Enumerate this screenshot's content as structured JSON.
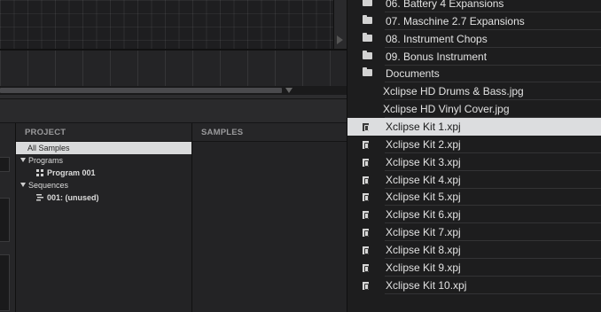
{
  "project_panel": {
    "header": "PROJECT",
    "items": [
      {
        "label": "All Samples"
      },
      {
        "label": "Programs"
      },
      {
        "label": "Program 001"
      },
      {
        "label": "Sequences"
      },
      {
        "label": "001: (unused)"
      }
    ]
  },
  "samples_panel": {
    "header": "SAMPLES"
  },
  "browser": {
    "items": [
      {
        "label": "06. Battery 4 Expansions",
        "icon": "folder-icon"
      },
      {
        "label": "07. Maschine 2.7 Expansions",
        "icon": "folder-icon"
      },
      {
        "label": "08. Instrument Chops",
        "icon": "folder-icon"
      },
      {
        "label": "09. Bonus Instrument",
        "icon": "folder-icon"
      },
      {
        "label": "Documents",
        "icon": "folder-icon"
      },
      {
        "label": "Xclipse HD Drums & Bass.jpg",
        "icon": "none"
      },
      {
        "label": "Xclipse  HD Vinyl Cover.jpg",
        "icon": "none"
      },
      {
        "label": "Xclipse Kit 1.xpj",
        "icon": "file-icon",
        "selected": true
      },
      {
        "label": "Xclipse Kit 2.xpj",
        "icon": "file-icon"
      },
      {
        "label": "Xclipse Kit 3.xpj",
        "icon": "file-icon"
      },
      {
        "label": "Xclipse Kit 4.xpj",
        "icon": "file-icon"
      },
      {
        "label": "Xclipse Kit 5.xpj",
        "icon": "file-icon"
      },
      {
        "label": "Xclipse Kit 6.xpj",
        "icon": "file-icon"
      },
      {
        "label": "Xclipse Kit 7.xpj",
        "icon": "file-icon"
      },
      {
        "label": "Xclipse Kit 8.xpj",
        "icon": "file-icon"
      },
      {
        "label": "Xclipse Kit 9.xpj",
        "icon": "file-icon"
      },
      {
        "label": "Xclipse Kit 10.xpj",
        "icon": "file-icon"
      }
    ]
  },
  "colors": {
    "selected_row": "#dcdddf",
    "background": "#1d1d1e"
  }
}
